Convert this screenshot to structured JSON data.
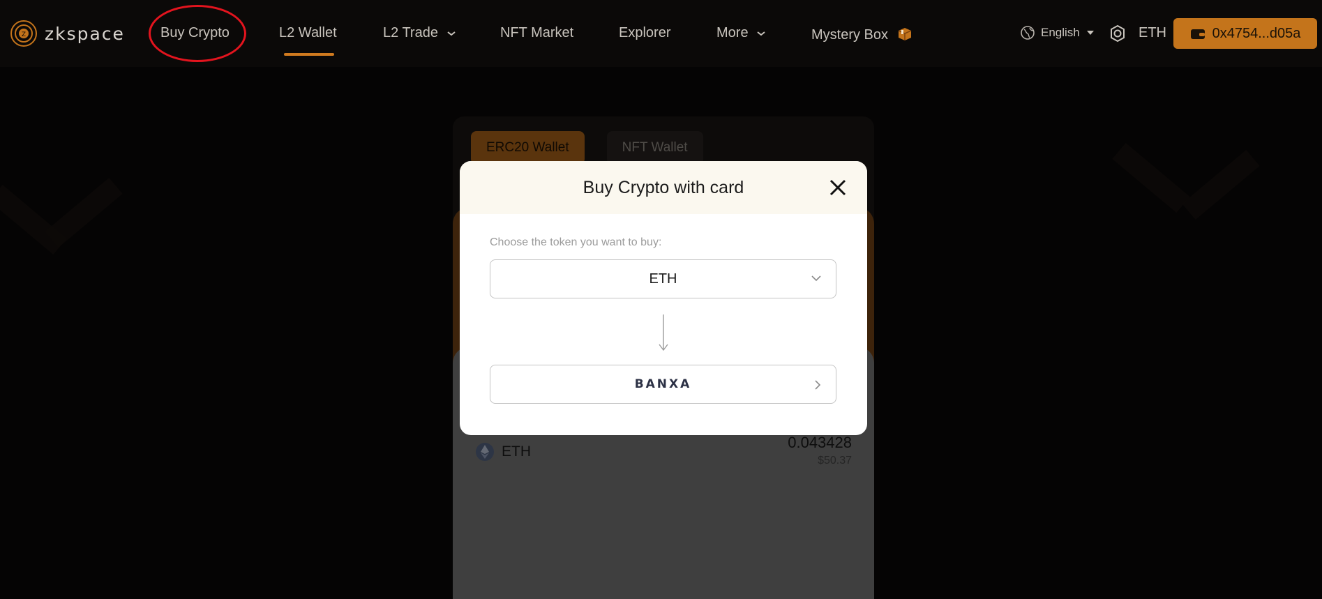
{
  "header": {
    "logo_text": "zkspace",
    "nav": [
      {
        "label": "Buy Crypto"
      },
      {
        "label": "L2 Wallet"
      },
      {
        "label": "L2 Trade"
      },
      {
        "label": "NFT Market"
      },
      {
        "label": "Explorer"
      },
      {
        "label": "More"
      },
      {
        "label": "Mystery Box"
      }
    ],
    "language": "English",
    "network": "ETH",
    "wallet_address": "0x4754...d05a"
  },
  "panel": {
    "tabs": [
      {
        "label": "ERC20 Wallet",
        "active": true
      },
      {
        "label": "NFT Wallet",
        "active": false
      }
    ],
    "asset": {
      "symbol": "ETH",
      "amount": "0.043428",
      "usd": "$50.37"
    }
  },
  "modal": {
    "title": "Buy Crypto with card",
    "choose_label": "Choose the token you want to buy:",
    "selected_token": "ETH",
    "provider": "BANXA"
  },
  "colors": {
    "accent": "#c4741b",
    "background": "#0b0908",
    "annotation": "#e3141e"
  }
}
